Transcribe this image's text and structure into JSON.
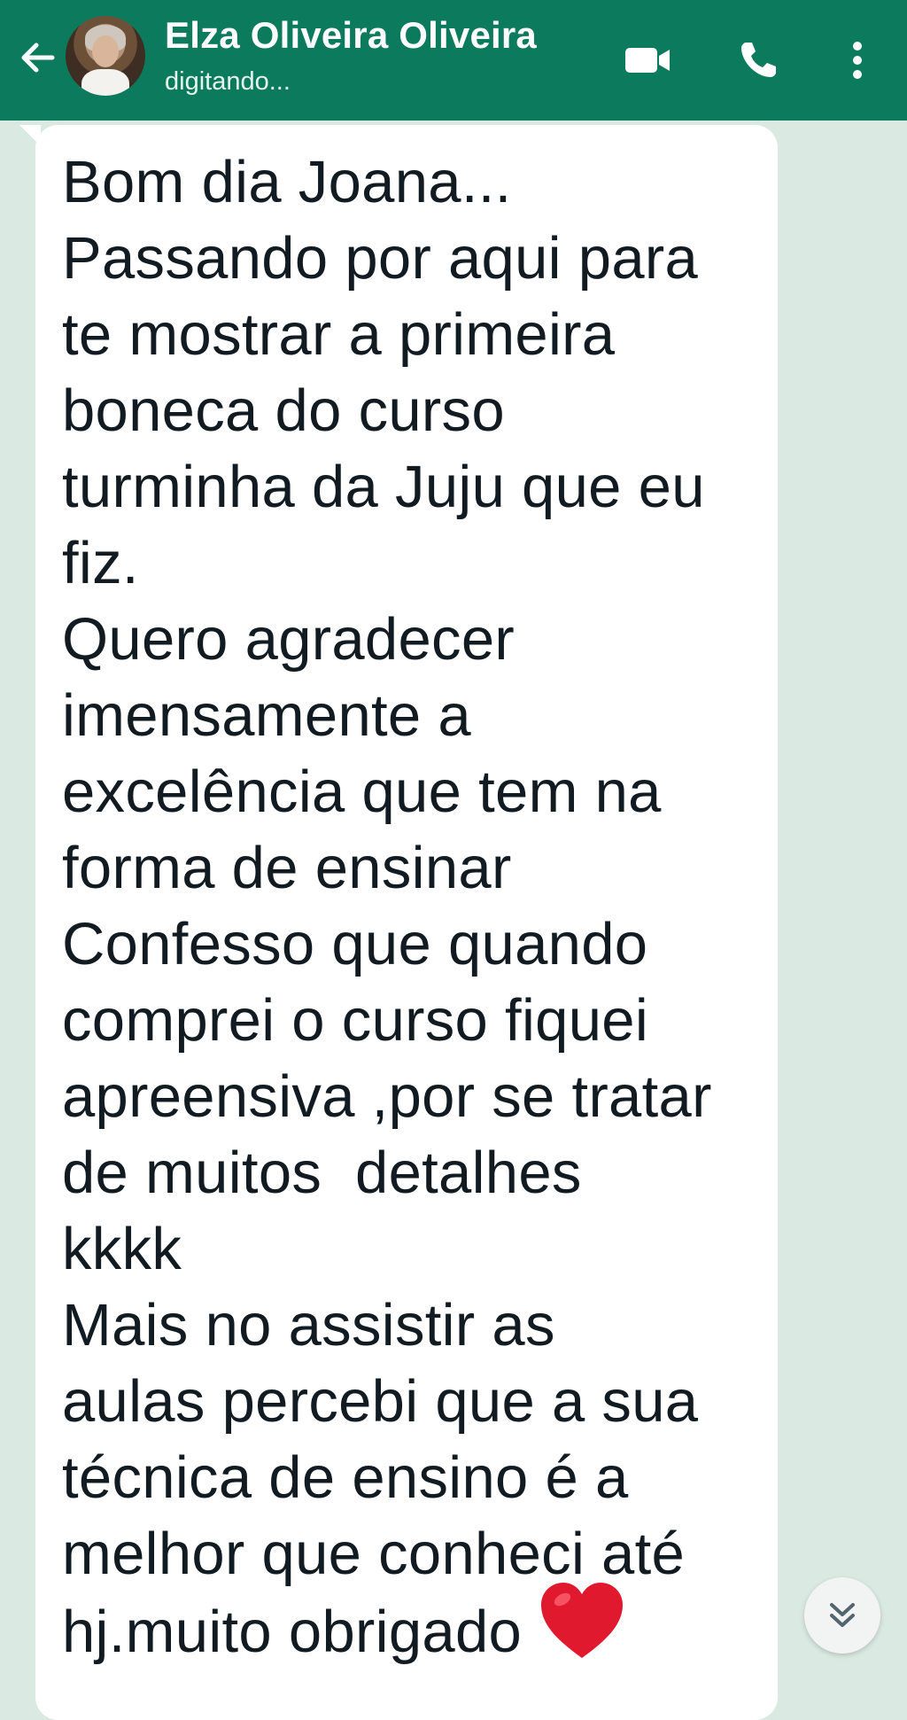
{
  "header": {
    "contact_name": "Elza Oliveira Oliveira",
    "status": "digitando...",
    "background_color": "#0b7a5d"
  },
  "icons": {
    "back": "arrow-left-icon",
    "video": "video-camera-icon",
    "call": "phone-icon",
    "menu": "more-vertical-icon",
    "scroll": "double-chevron-down-icon",
    "emoji": "red-heart-emoji"
  },
  "message": {
    "lines": [
      "Bom dia Joana...",
      "Passando por aqui para",
      "te mostrar a primeira",
      "boneca do curso",
      "turminha da Juju que eu",
      "fiz.",
      "Quero agradecer",
      "imensamente a",
      "excelência que tem na",
      "forma de ensinar",
      "Confesso que quando",
      "comprei o curso fiquei",
      "apreensiva ,por se tratar",
      "de muitos  detalhes",
      "kkkk",
      "Mais no assistir as",
      "aulas percebi que a sua",
      "técnica de ensino é a",
      "melhor que conheci até",
      "hj.muito obrigado"
    ]
  },
  "colors": {
    "chat_background": "#dbe9e3",
    "bubble": "#ffffff",
    "text": "#111b21",
    "heart": "#e0192f"
  }
}
